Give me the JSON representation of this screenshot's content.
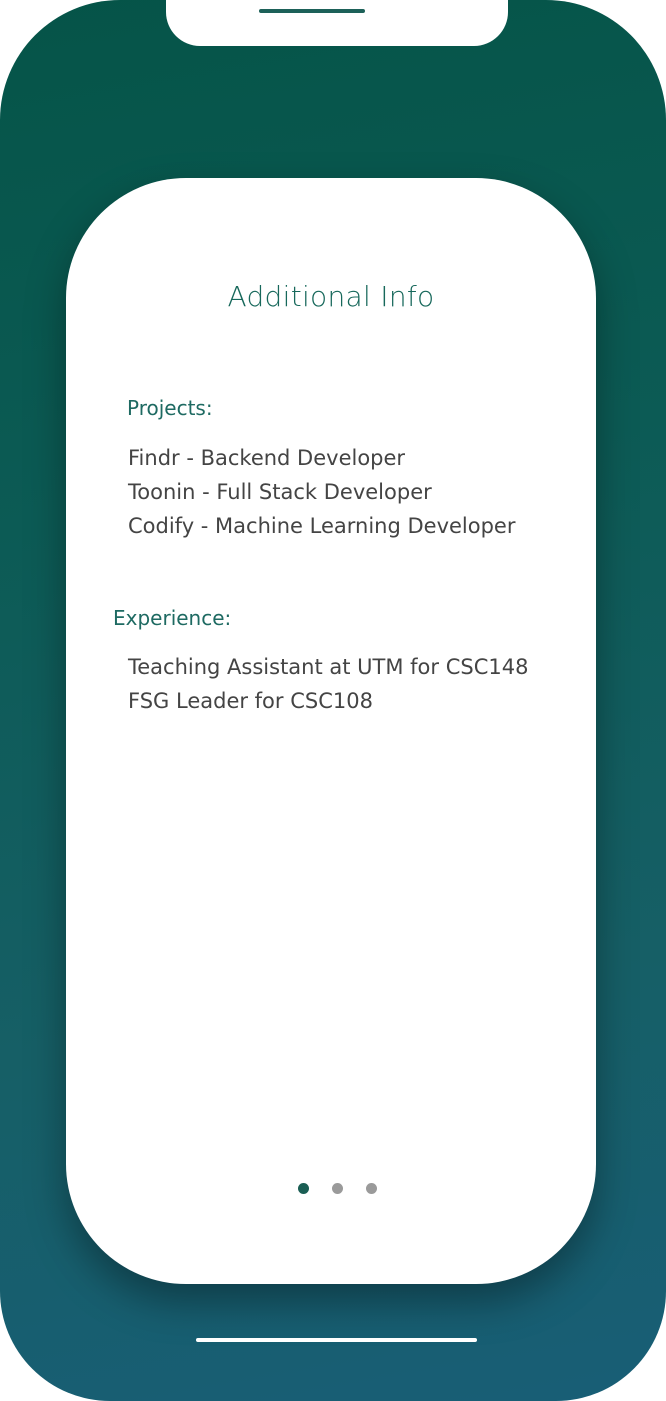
{
  "screen": {
    "title": "Additional Info"
  },
  "projects": {
    "heading": "Projects:",
    "items": [
      "Findr - Backend Developer",
      "Toonin - Full Stack Developer",
      "Codify - Machine Learning Developer"
    ]
  },
  "experience": {
    "heading": "Experience:",
    "items": [
      "Teaching Assistant at UTM for CSC148",
      "FSG Leader for CSC108"
    ]
  },
  "pager": {
    "total_pages": 3,
    "active_page": 1
  },
  "colors": {
    "frame_gradient_start": "#055448",
    "frame_gradient_end": "#185e76",
    "accent_teal": "#17685b",
    "body_text": "#444444",
    "dot_active": "#1a5e54",
    "dot_inactive": "#9a9a9a"
  }
}
